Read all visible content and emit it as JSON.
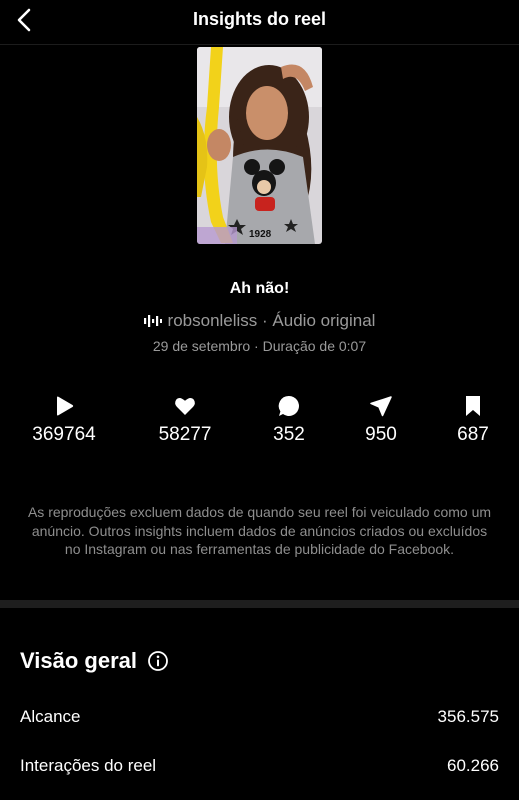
{
  "header": {
    "title": "Insights do reel",
    "back_icon": "chevron-left-icon"
  },
  "reel": {
    "title": "Ah não!",
    "audio_label": "robsonleliss · Áudio original",
    "meta": "29 de setembro · Duração de 0:07",
    "thumbnail_shirt_text": "1928"
  },
  "stats": [
    {
      "icon": "play-icon",
      "value": "369764"
    },
    {
      "icon": "heart-icon",
      "value": "58277"
    },
    {
      "icon": "comment-icon",
      "value": "352"
    },
    {
      "icon": "share-icon",
      "value": "950"
    },
    {
      "icon": "bookmark-icon",
      "value": "687"
    }
  ],
  "note": "As reproduções excluem dados de quando seu reel foi veiculado como um anúncio. Outros insights incluem dados de anúncios criados ou excluídos no Instagram ou nas ferramentas de publicidade do Facebook.",
  "overview": {
    "title": "Visão geral",
    "rows": [
      {
        "label": "Alcance",
        "value": "356.575"
      },
      {
        "label": "Interações do reel",
        "value": "60.266"
      }
    ]
  }
}
